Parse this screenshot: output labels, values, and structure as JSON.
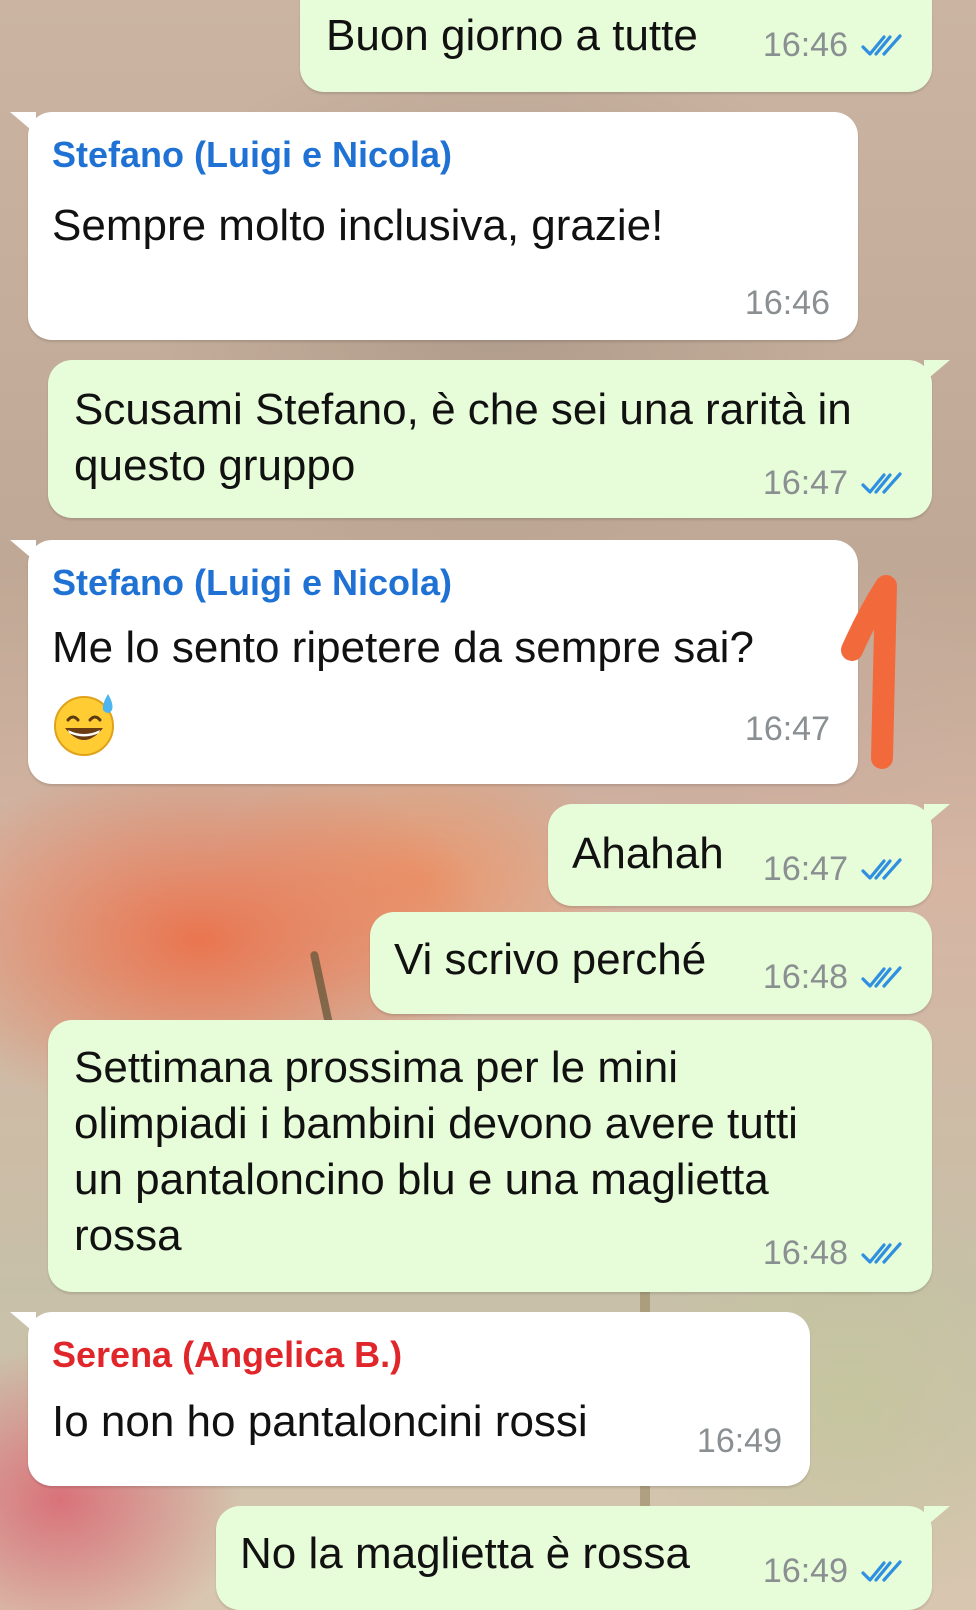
{
  "colors": {
    "outgoing_bubble": "#e7fcd8",
    "incoming_bubble": "#ffffff",
    "read_ticks": "#2f8fe0",
    "meta_text": "#8a8f92",
    "annotation": "#f26a3c"
  },
  "messages": [
    {
      "direction": "out",
      "text": "Buon giorno a tutte",
      "time": "16:46",
      "status_icon": "double-check-icon"
    },
    {
      "direction": "in",
      "sender": "Stefano (Luigi e Nicola)",
      "sender_color": "#1f72d4",
      "text": "Sempre molto inclusiva, grazie!",
      "time": "16:46"
    },
    {
      "direction": "out",
      "lines": [
        "Scusami Stefano, è che sei una rarità in",
        "questo gruppo"
      ],
      "time": "16:47",
      "status_icon": "double-check-icon"
    },
    {
      "direction": "in",
      "sender": "Stefano (Luigi e Nicola)",
      "sender_color": "#1f72d4",
      "text": "Me lo sento ripetere da sempre sai?",
      "emoji": "grinning-face-with-sweat-icon",
      "time": "16:47"
    },
    {
      "direction": "out",
      "text": "Ahahah",
      "time": "16:47",
      "status_icon": "double-check-icon"
    },
    {
      "direction": "out",
      "text": "Vi scrivo perché",
      "time": "16:48",
      "status_icon": "double-check-icon"
    },
    {
      "direction": "out",
      "lines": [
        "Settimana prossima per le mini",
        "olimpiadi i bambini devono avere tutti",
        "un pantaloncino blu e una maglietta",
        "rossa"
      ],
      "time": "16:48",
      "status_icon": "double-check-icon"
    },
    {
      "direction": "in",
      "sender": "Serena (Angelica B.)",
      "sender_color": "#e0262b",
      "text": "Io non ho pantaloncini rossi",
      "time": "16:49"
    },
    {
      "direction": "out",
      "text": "No la maglietta è rossa",
      "time": "16:49",
      "status_icon": "double-check-icon"
    }
  ],
  "annotation": {
    "icon": "handwritten-number-one-mark"
  }
}
